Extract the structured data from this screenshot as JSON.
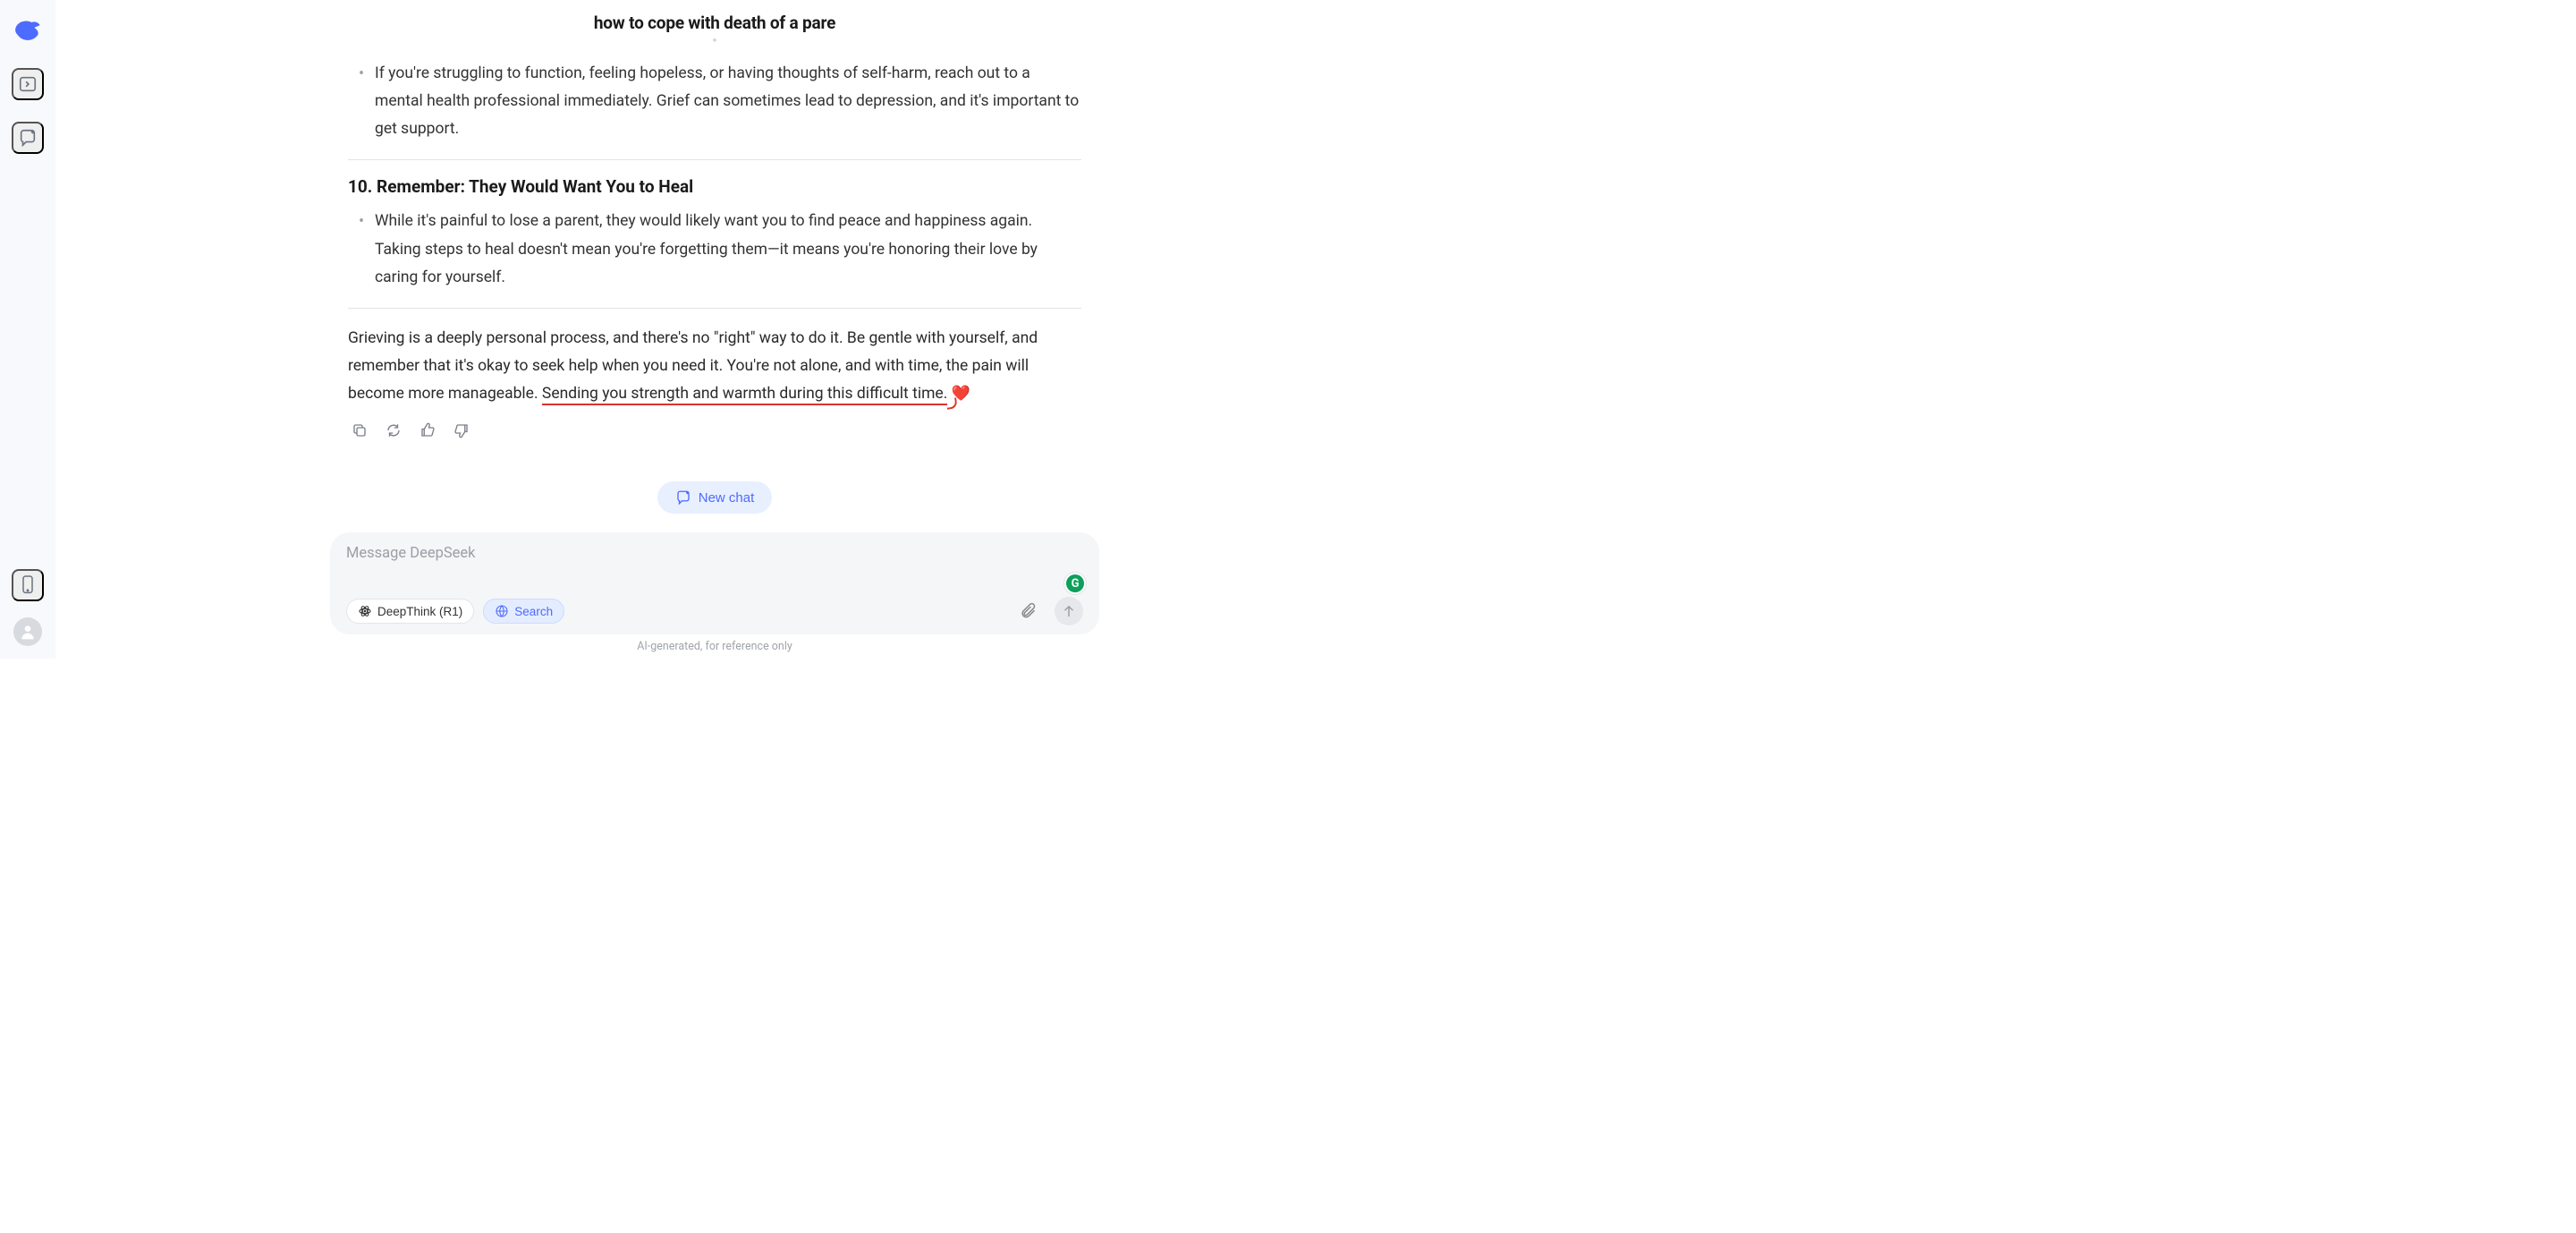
{
  "header": {
    "title": "how to cope with death of a pare"
  },
  "response": {
    "item9": {
      "bullet": "If you're struggling to function, feeling hopeless, or having thoughts of self-harm, reach out to a mental health professional immediately. Grief can sometimes lead to depression, and it's important to get support."
    },
    "item10": {
      "number": "10.",
      "heading": "Remember: They Would Want You to Heal",
      "bullet": "While it's painful to lose a parent, they would likely want you to find peace and happiness again. Taking steps to heal doesn't mean you're forgetting them—it means you're honoring their love by caring for yourself."
    },
    "closing": {
      "pre": "Grieving is a deeply personal process, and there's no \"right\" way to do it. Be gentle with yourself, and remember that it's okay to seek help when you need it. You're not alone, and with time, the pain will become more manageable. ",
      "underlined": "Sending you strength and warmth during this difficult time.",
      "heart": "❤️"
    }
  },
  "buttons": {
    "new_chat": "New chat"
  },
  "input": {
    "placeholder": "Message DeepSeek",
    "chips": {
      "deepthink": "DeepThink (R1)",
      "search": "Search"
    }
  },
  "footer": {
    "disclaimer": "AI-generated, for reference only"
  }
}
